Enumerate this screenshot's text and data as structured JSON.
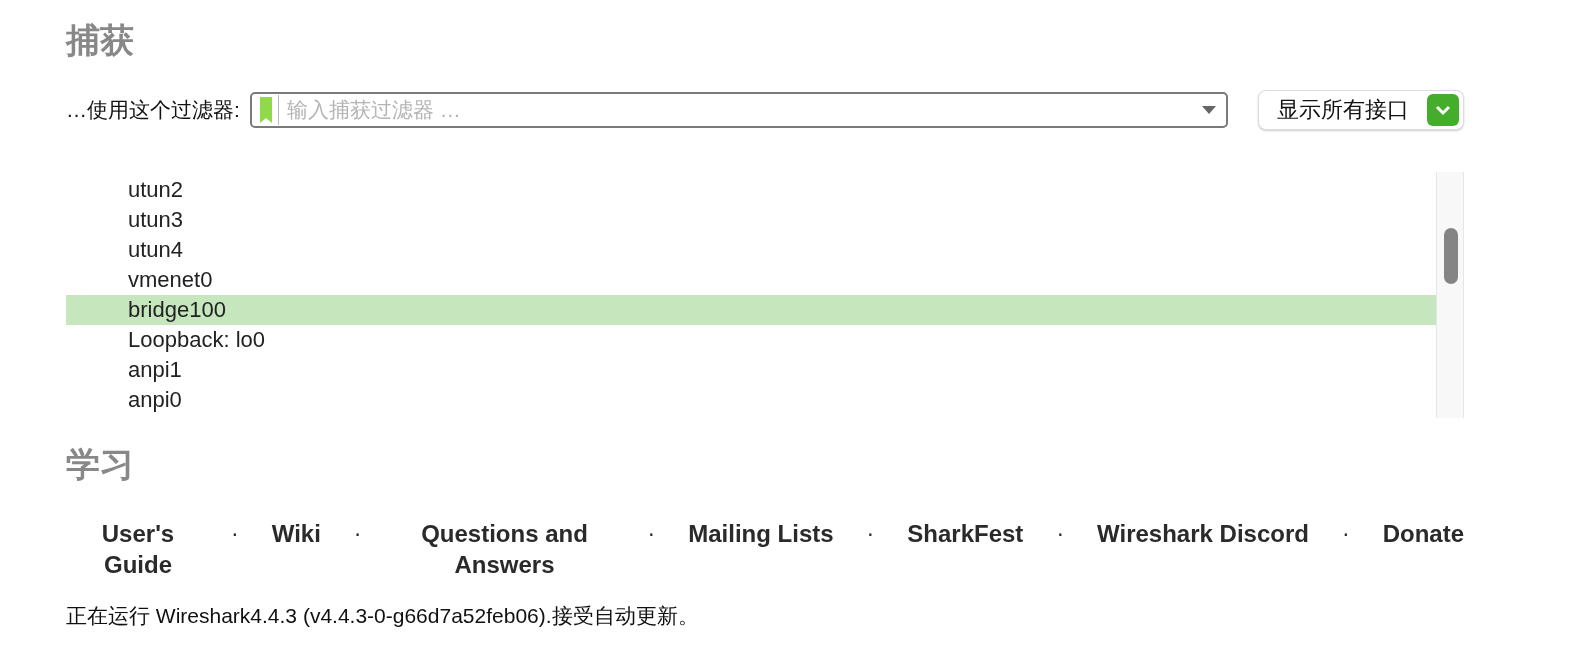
{
  "capture": {
    "heading": "捕获",
    "filter_label": "…使用这个过滤器:",
    "filter": {
      "placeholder": "输入捕获过滤器 …"
    },
    "interfaces_button": "显示所有接口",
    "interfaces": [
      {
        "name": "utun2",
        "selected": false
      },
      {
        "name": "utun3",
        "selected": false
      },
      {
        "name": "utun4",
        "selected": false
      },
      {
        "name": "vmenet0",
        "selected": false
      },
      {
        "name": "bridge100",
        "selected": true
      },
      {
        "name": "Loopback: lo0",
        "selected": false
      },
      {
        "name": "anpi1",
        "selected": false
      },
      {
        "name": "anpi0",
        "selected": false
      }
    ]
  },
  "learn": {
    "heading": "学习",
    "links": [
      {
        "label": "User's Guide"
      },
      {
        "label": "Wiki"
      },
      {
        "label": "Questions and Answers"
      },
      {
        "label": "Mailing Lists"
      },
      {
        "label": "SharkFest"
      },
      {
        "label": "Wireshark Discord"
      },
      {
        "label": "Donate"
      }
    ],
    "separator": "·"
  },
  "status": "正在运行 Wireshark4.4.3 (v4.4.3-0-g66d7a52feb06).接受自动更新。"
}
